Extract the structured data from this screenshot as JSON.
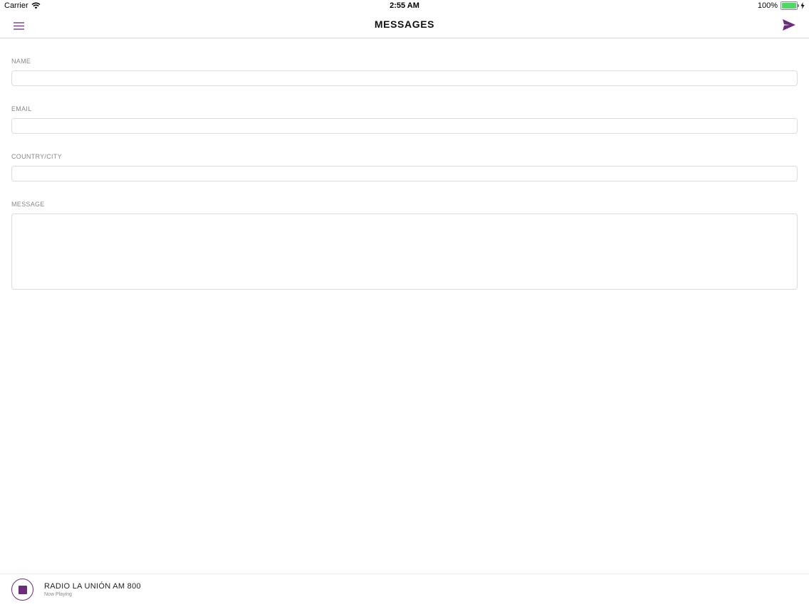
{
  "status_bar": {
    "carrier": "Carrier",
    "time": "2:55 AM",
    "battery": "100%",
    "battery_level": 1.0,
    "icons": [
      "wifi-icon",
      "battery-icon",
      "charging-icon"
    ]
  },
  "nav": {
    "title": "MESSAGES",
    "menu_icon": "hamburger-menu-icon",
    "send_icon": "paper-plane-send-icon"
  },
  "form": {
    "name": {
      "label": "NAME",
      "value": "",
      "placeholder": ""
    },
    "email": {
      "label": "EMAIL",
      "value": "",
      "placeholder": ""
    },
    "location": {
      "label": "COUNTRY/CITY",
      "value": "",
      "placeholder": ""
    },
    "message": {
      "label": "MESSAGE",
      "value": "",
      "placeholder": ""
    }
  },
  "player": {
    "station": "RADIO LA UNIÓN AM 800",
    "status": "Now Playing",
    "control_icon": "stop-icon"
  },
  "colors": {
    "accent": "#6b2c7e",
    "border": "#dcdcdc",
    "label": "#888888",
    "battery": "#4cd964"
  }
}
